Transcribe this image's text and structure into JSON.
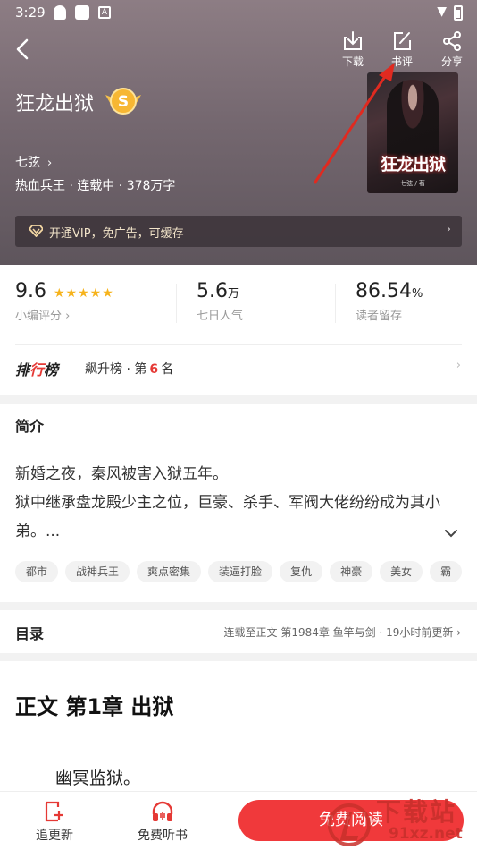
{
  "status_bar": {
    "time": "3:29"
  },
  "header": {
    "actions": [
      {
        "label": "下载",
        "icon": "download-icon"
      },
      {
        "label": "书评",
        "icon": "edit-icon"
      },
      {
        "label": "分享",
        "icon": "share-icon"
      }
    ],
    "book_title": "狂龙出狱",
    "author": "七弦",
    "author_chevron": "›",
    "meta": "热血兵王 · 连载中 · 378万字",
    "cover_title": "狂龙出狱",
    "cover_author": "七弦 / 著",
    "vip_text": "开通VIP，免广告，可缓存",
    "vip_chevron": "›",
    "accent_color": "#e53935"
  },
  "stats": [
    {
      "value": "9.6",
      "unit": "",
      "label": "小编评分 ›",
      "stars": "★★★★★"
    },
    {
      "value": "5.6",
      "unit": "万",
      "label": "七日人气"
    },
    {
      "value": "86.54",
      "unit": "%",
      "label": "读者留存"
    }
  ],
  "ranking": {
    "title_a": "排",
    "title_b": "行",
    "title_c": "榜",
    "list_name": "飙升榜 · 第",
    "rank": "6",
    "suffix": "名",
    "chevron": "›"
  },
  "intro": {
    "heading": "简介",
    "text_line1": "新婚之夜，秦风被害入狱五年。",
    "text_line2": "狱中继承盘龙殿少主之位，巨豪、杀手、军阀大佬纷纷成为其小弟。...",
    "expand_icon": "⌄",
    "tags": [
      "都市",
      "战神兵王",
      "爽点密集",
      "装逼打脸",
      "复仇",
      "神豪",
      "美女",
      "霸"
    ]
  },
  "toc": {
    "heading": "目录",
    "latest": "连载至正文 第1984章 鱼竿与剑 · 19小时前更新 ›"
  },
  "chapter": {
    "title": "正文 第1章 出狱",
    "first_line": "幽冥监狱。"
  },
  "bottom_bar": {
    "follow_label": "追更新",
    "listen_label": "免费听书",
    "read_label": "免费阅读",
    "read_color": "#f0393b"
  },
  "watermark": {
    "text1": "下载站",
    "text2": "91xz.net"
  }
}
